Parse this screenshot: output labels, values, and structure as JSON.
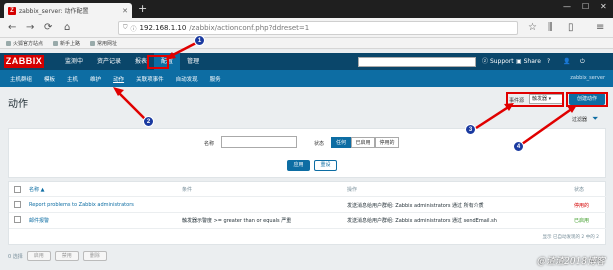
{
  "browser": {
    "tab_title": "zabbix_server: 动作配置",
    "favicon_letter": "Z",
    "url_host": "192.168.1.10",
    "url_path": "/zabbix/actionconf.php?ddreset=1",
    "bookmarks": [
      "火狐官方站点",
      "新手上路",
      "常用网址"
    ]
  },
  "header": {
    "logo": "ZABBIX",
    "menu": [
      "监测中",
      "资产记录",
      "报表",
      "配置",
      "管理"
    ],
    "support": "Support",
    "share": "Share",
    "help": "?",
    "server_label": "zabbix_server"
  },
  "submenu": {
    "items": [
      "主机群组",
      "模板",
      "主机",
      "维护",
      "动作",
      "关联项事件",
      "自动发现",
      "服务"
    ],
    "selected_index": 4
  },
  "page": {
    "title": "动作",
    "event_source_label": "事件源",
    "event_source_value": "触发器",
    "create_button": "创建动作",
    "filter_tab": "过滤器"
  },
  "filter": {
    "name_label": "名称",
    "status_label": "状态",
    "status_options": [
      "任何",
      "已启用",
      "停用的"
    ],
    "status_selected": 0,
    "apply": "应用",
    "reset": "重设"
  },
  "table": {
    "headers": [
      "名称 ▲",
      "条件",
      "操作",
      "状态"
    ],
    "rows": [
      {
        "name": "Report problems to Zabbix administrators",
        "conditions": "",
        "operations": "发送消息给用户群组: Zabbix administrators 通过 所有介质",
        "status": "停用的"
      },
      {
        "name": "邮件报警",
        "conditions": "触发器示警度 >= greater than or equals 严重",
        "operations": "发送消息给用户群组: Zabbix administrators 通过 sendEmail.sh",
        "status": "已启用"
      }
    ],
    "displaying": "显示 已自动发现的 2 中的 2"
  },
  "actions_bar": {
    "count": "0 选择",
    "buttons": [
      "启用",
      "禁用",
      "删除"
    ]
  },
  "watermark": "@渣渣2018博客",
  "annotations": [
    "1",
    "2",
    "3",
    "4"
  ],
  "colors": {
    "header_bg": "#0a466a",
    "submenu_bg": "#0d6da3",
    "logo_red": "#d40000",
    "annotation_red": "#e00000",
    "badge_blue": "#1a3aa0"
  }
}
